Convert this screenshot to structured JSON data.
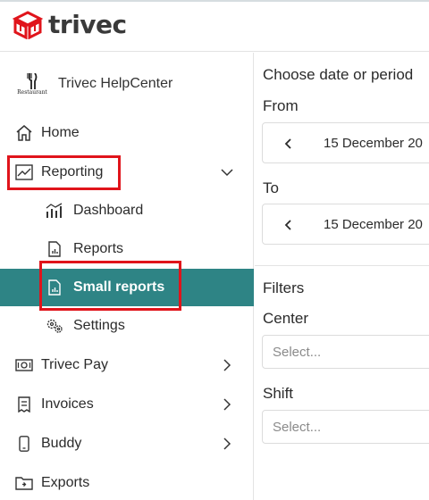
{
  "brand": {
    "name": "trivec",
    "logo_color": "#e0141b"
  },
  "org": {
    "name": "Trivec HelpCenter",
    "avatar_text": "Restaurant"
  },
  "sidebar": {
    "items": [
      {
        "label": "Home",
        "icon": "home-icon"
      },
      {
        "label": "Reporting",
        "icon": "chart-trend-icon",
        "expanded": true
      },
      {
        "label": "Dashboard",
        "icon": "dashboard-icon"
      },
      {
        "label": "Reports",
        "icon": "report-doc-icon"
      },
      {
        "label": "Small reports",
        "icon": "report-doc-icon",
        "active": true
      },
      {
        "label": "Settings",
        "icon": "gears-icon"
      },
      {
        "label": "Trivec Pay",
        "icon": "cash-icon"
      },
      {
        "label": "Invoices",
        "icon": "invoice-icon"
      },
      {
        "label": "Buddy",
        "icon": "phone-icon"
      },
      {
        "label": "Exports",
        "icon": "export-folder-icon"
      }
    ],
    "active_color": "#2e8485"
  },
  "main": {
    "period_title": "Choose date or period",
    "from_label": "From",
    "from_value": "15 December 20",
    "to_label": "To",
    "to_value": "15 December 20",
    "filters_title": "Filters",
    "center_label": "Center",
    "center_placeholder": "Select...",
    "shift_label": "Shift",
    "shift_placeholder": "Select..."
  },
  "highlight_color": "#e0141b"
}
